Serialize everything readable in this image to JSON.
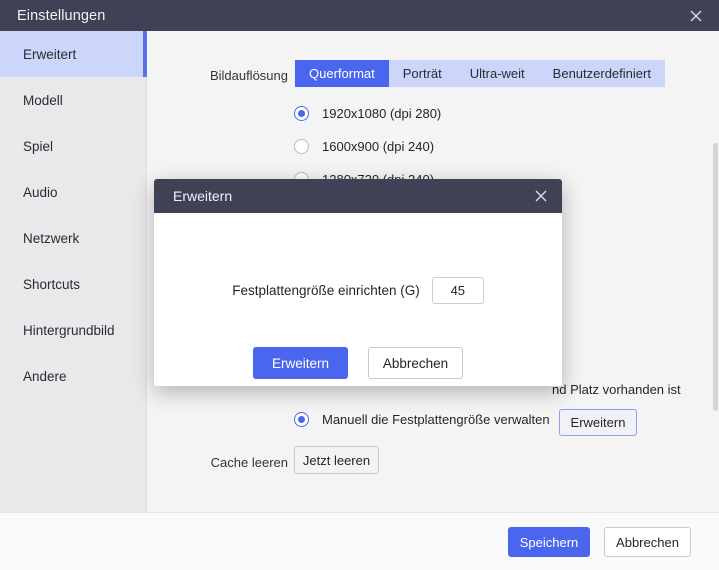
{
  "window": {
    "title": "Einstellungen",
    "close_icon": "close-icon"
  },
  "sidebar": {
    "items": [
      {
        "label": "Erweitert",
        "active": true
      },
      {
        "label": "Modell",
        "active": false
      },
      {
        "label": "Spiel",
        "active": false
      },
      {
        "label": "Audio",
        "active": false
      },
      {
        "label": "Netzwerk",
        "active": false
      },
      {
        "label": "Shortcuts",
        "active": false
      },
      {
        "label": "Hintergrundbild",
        "active": false
      },
      {
        "label": "Andere",
        "active": false
      }
    ]
  },
  "content": {
    "resolution": {
      "label": "Bildauflösung",
      "tabs": [
        {
          "label": "Querformat",
          "active": true
        },
        {
          "label": "Porträt",
          "active": false
        },
        {
          "label": "Ultra-weit",
          "active": false
        },
        {
          "label": "Benutzerdefiniert",
          "active": false
        }
      ],
      "options": [
        {
          "label": "1920x1080  (dpi 280)",
          "selected": true
        },
        {
          "label": "1600x900  (dpi 240)",
          "selected": false
        },
        {
          "label": "1280x720  (dpi 240)",
          "selected": false
        }
      ]
    },
    "storage": {
      "note_visible_text": "nd Platz vorhanden ist",
      "manual_option": {
        "label": "Manuell die Festplattengröße verwalten",
        "selected": true
      },
      "expand_button": "Erweitern"
    },
    "cache": {
      "label": "Cache leeren",
      "button": "Jetzt leeren"
    }
  },
  "footer": {
    "save": "Speichern",
    "cancel": "Abbrechen"
  },
  "modal": {
    "title": "Erweitern",
    "close_icon": "close-icon",
    "field_label": "Festplattengröße einrichten (G)",
    "field_value": "45",
    "field_placeholder": "",
    "confirm": "Erweitern",
    "cancel": "Abbrechen"
  },
  "colors": {
    "titlebar": "#3f4254",
    "accent": "#4a66ef",
    "accent_soft": "#ccd6fb",
    "sidebar": "#e9e9eb",
    "content": "#f4f4f5"
  }
}
